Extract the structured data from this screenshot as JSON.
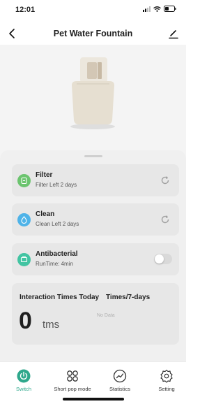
{
  "status_bar": {
    "time": "12:01"
  },
  "header": {
    "title": "Pet Water Fountain"
  },
  "cards": [
    {
      "title": "Filter",
      "subtitle": "Filter Left 2 days",
      "icon": "filter-icon",
      "color": "#6cc46f"
    },
    {
      "title": "Clean",
      "subtitle": "Clean Left 2 days",
      "icon": "clean-icon",
      "color": "#4fb3e8"
    },
    {
      "title": "Antibacterial",
      "subtitle": "RunTime: 4min",
      "icon": "antibacterial-icon",
      "color": "#42c4a2",
      "enabled": false
    }
  ],
  "stats": {
    "label": "Interaction Times Today",
    "week_label": "Times/7-days",
    "value": "0",
    "unit": "tms",
    "no_data": "No Data"
  },
  "tabs": [
    {
      "label": "Switch",
      "icon": "power-icon",
      "active": true
    },
    {
      "label": "Short pop mode",
      "icon": "grid-icon",
      "active": false
    },
    {
      "label": "Statistics",
      "icon": "chart-icon",
      "active": false
    },
    {
      "label": "Setting",
      "icon": "gear-icon",
      "active": false
    }
  ],
  "colors": {
    "accent": "#2fa88c",
    "card_bg": "#e7e7e7",
    "sheet_bg": "#f0f0f0"
  }
}
